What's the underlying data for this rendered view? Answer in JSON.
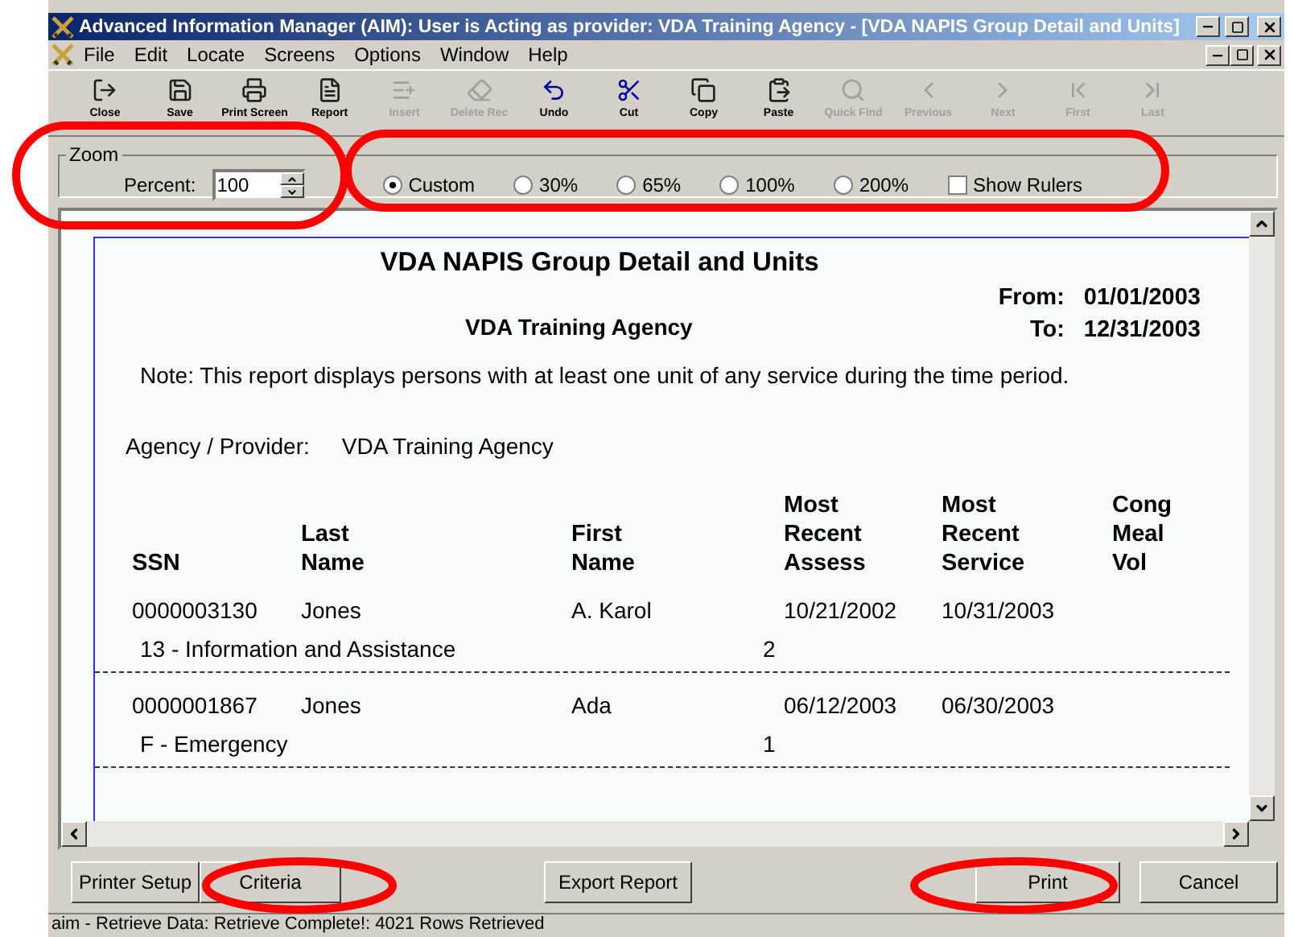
{
  "window": {
    "title": "Advanced Information Manager (AIM):  User is Acting as provider:  VDA Training Agency - [VDA NAPIS Group Detail and Units]"
  },
  "menu": [
    "File",
    "Edit",
    "Locate",
    "Screens",
    "Options",
    "Window",
    "Help"
  ],
  "toolbar": [
    {
      "label": "Close",
      "kind": "close",
      "disabled": false
    },
    {
      "label": "Save",
      "kind": "save",
      "disabled": false
    },
    {
      "label": "Print Screen",
      "kind": "print",
      "disabled": false
    },
    {
      "label": "Report",
      "kind": "report",
      "disabled": false
    },
    {
      "label": "Insert",
      "kind": "insert",
      "disabled": true
    },
    {
      "label": "Delete Rec",
      "kind": "delete",
      "disabled": true
    },
    {
      "label": "Undo",
      "kind": "undo",
      "disabled": false
    },
    {
      "label": "Cut",
      "kind": "cut",
      "disabled": false
    },
    {
      "label": "Copy",
      "kind": "copy",
      "disabled": false
    },
    {
      "label": "Paste",
      "kind": "paste",
      "disabled": false
    },
    {
      "label": "Quick Find",
      "kind": "find",
      "disabled": true
    },
    {
      "label": "Previous",
      "kind": "previous",
      "disabled": true
    },
    {
      "label": "Next",
      "kind": "next",
      "disabled": true
    },
    {
      "label": "First",
      "kind": "first",
      "disabled": true
    },
    {
      "label": "Last",
      "kind": "last",
      "disabled": true
    }
  ],
  "zoom": {
    "legend": "Zoom",
    "percent_label": "Percent:",
    "percent": "100",
    "options": [
      {
        "label": "Custom",
        "selected": true
      },
      {
        "label": "30%",
        "selected": false
      },
      {
        "label": "65%",
        "selected": false
      },
      {
        "label": "100%",
        "selected": false
      },
      {
        "label": "200%",
        "selected": false
      }
    ],
    "show_rulers": {
      "label": "Show Rulers",
      "checked": false
    }
  },
  "report": {
    "title": "VDA NAPIS Group Detail and Units",
    "agency_heading": "VDA Training Agency",
    "from_label": "From:",
    "from": "01/01/2003",
    "to_label": "To:",
    "to": "12/31/2003",
    "note": "Note:  This report displays persons with at least one unit of any service during the time period.",
    "provider_label": "Agency / Provider:",
    "provider": "VDA Training Agency",
    "columns": [
      "SSN",
      "Last Name",
      "First Name",
      "Most Recent Assess",
      "Most Recent Service",
      "Cong Meal Vol"
    ],
    "rows": [
      {
        "ssn": "0000003130",
        "last": "Jones",
        "first": "A. Karol",
        "assess": "10/21/2002",
        "service_date": "10/31/2003",
        "service": "13 - Information and  Assistance",
        "units": "2"
      },
      {
        "ssn": "0000001867",
        "last": "Jones",
        "first": "Ada",
        "assess": "06/12/2003",
        "service_date": "06/30/2003",
        "service": "F - Emergency",
        "units": "1"
      }
    ]
  },
  "buttons": [
    "Printer Setup",
    "Criteria",
    "Export Report",
    "Print",
    "Cancel"
  ],
  "status_bar": "aim - Retrieve Data:  Retrieve Complete!:  4021 Rows Retrieved"
}
